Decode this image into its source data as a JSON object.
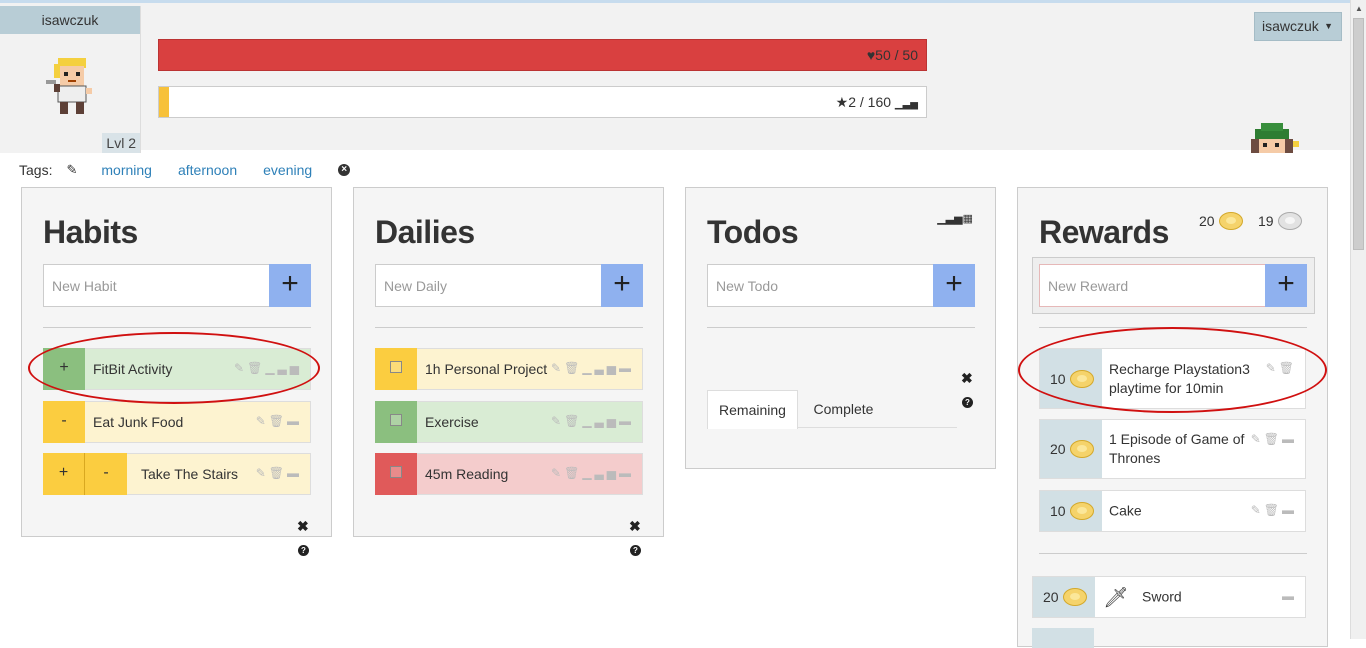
{
  "user": {
    "name": "isawczuk",
    "level": "Lvl 2"
  },
  "stats": {
    "hp_text": "50 / 50",
    "xp_text": "2 / 160",
    "xp_fraction": 0.0125
  },
  "tags": {
    "label": "Tags:",
    "items": [
      "morning",
      "afternoon",
      "evening"
    ]
  },
  "habits": {
    "title": "Habits",
    "placeholder": "New Habit",
    "items": [
      {
        "label": "FitBit Activity",
        "color": "green",
        "controls": [
          "+"
        ]
      },
      {
        "label": "Eat Junk Food",
        "color": "yellow",
        "controls": [
          "-"
        ]
      },
      {
        "label": "Take The Stairs",
        "color": "yellow",
        "controls": [
          "+",
          "-"
        ]
      }
    ]
  },
  "dailies": {
    "title": "Dailies",
    "placeholder": "New Daily",
    "items": [
      {
        "label": "1h Personal Project",
        "color": "yellow"
      },
      {
        "label": "Exercise",
        "color": "green"
      },
      {
        "label": "45m Reading",
        "color": "red"
      }
    ]
  },
  "todos": {
    "title": "Todos",
    "placeholder": "New Todo",
    "tabs": [
      "Remaining",
      "Complete"
    ]
  },
  "rewards": {
    "title": "Rewards",
    "gold": "20",
    "silver": "19",
    "placeholder": "New Reward",
    "items": [
      {
        "price": "10",
        "label": "Recharge Playstation3 playtime for 10min"
      },
      {
        "price": "20",
        "label": "1 Episode of Game of Thrones"
      },
      {
        "price": "10",
        "label": "Cake"
      }
    ],
    "shop": [
      {
        "price": "20",
        "label": "Sword"
      }
    ]
  },
  "colors": {
    "hp": "#d94040",
    "xp": "#f7c13a",
    "add": "#8fb1ef",
    "annotation": "#d01010"
  }
}
